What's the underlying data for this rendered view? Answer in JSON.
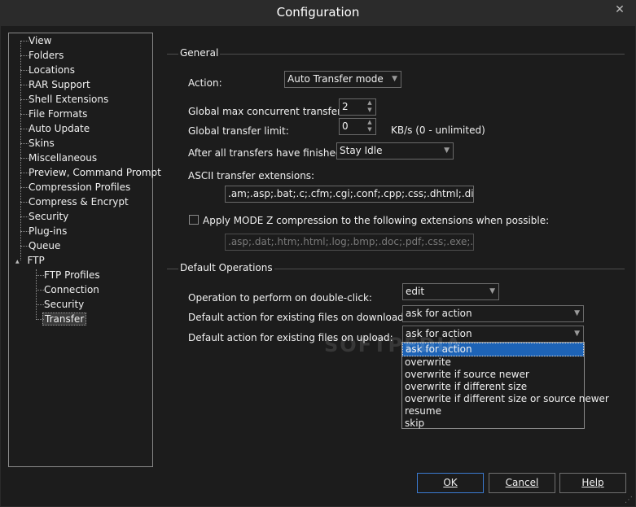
{
  "window": {
    "title": "Configuration",
    "close_glyph": "✕"
  },
  "tree": {
    "items": [
      {
        "label": "View"
      },
      {
        "label": "Folders"
      },
      {
        "label": "Locations"
      },
      {
        "label": "RAR Support"
      },
      {
        "label": "Shell Extensions"
      },
      {
        "label": "File Formats"
      },
      {
        "label": "Auto Update"
      },
      {
        "label": "Skins"
      },
      {
        "label": "Miscellaneous"
      },
      {
        "label": "Preview, Command Prompt"
      },
      {
        "label": "Compression Profiles"
      },
      {
        "label": "Compress & Encrypt"
      },
      {
        "label": "Security"
      },
      {
        "label": "Plug-ins"
      },
      {
        "label": "Queue"
      },
      {
        "label": "FTP"
      }
    ],
    "ftp_children": [
      {
        "label": "FTP Profiles"
      },
      {
        "label": "Connection"
      },
      {
        "label": "Security"
      },
      {
        "label": "Transfer"
      }
    ],
    "expander": "▲"
  },
  "general": {
    "header": "General",
    "action_label": "Action:",
    "action_value": "Auto Transfer mode",
    "max_transfers_label": "Global max concurrent transfers:",
    "max_transfers_value": "2",
    "transfer_limit_label": "Global transfer limit:",
    "transfer_limit_value": "0",
    "transfer_limit_unit": "KB/s (0 - unlimited)",
    "after_label": "After all transfers have finished:",
    "after_value": "Stay Idle",
    "ascii_label": "ASCII transfer extensions:",
    "ascii_value": ".am;.asp;.bat;.c;.cfm;.cgi;.conf;.cpp;.css;.dhtml;.diz;.h;.hpp",
    "modez_label": "Apply MODE Z compression to the following extensions when possible:",
    "modez_value": ".asp;.dat;.htm;.html;.log;.bmp;.doc;.pdf;.css;.exe;.js;.php;."
  },
  "default_ops": {
    "header": "Default Operations",
    "dblclick_label": "Operation to perform on double-click:",
    "dblclick_value": "edit",
    "download_label": "Default action for existing files on download:",
    "download_value": "ask for action",
    "upload_label": "Default action for existing files on upload:",
    "upload_value": "ask for action",
    "upload_options": [
      "ask for action",
      "overwrite",
      "overwrite if source newer",
      "overwrite if different size",
      "overwrite if different size or source newer",
      "resume",
      "skip"
    ]
  },
  "buttons": {
    "ok": "OK",
    "cancel": "Cancel",
    "help": "Help"
  },
  "watermark": "SOFTPEDIA",
  "icons": {
    "dropdown_arrow": "▼",
    "spin_up": "▲",
    "spin_down": "▼",
    "grip": "⋰"
  }
}
